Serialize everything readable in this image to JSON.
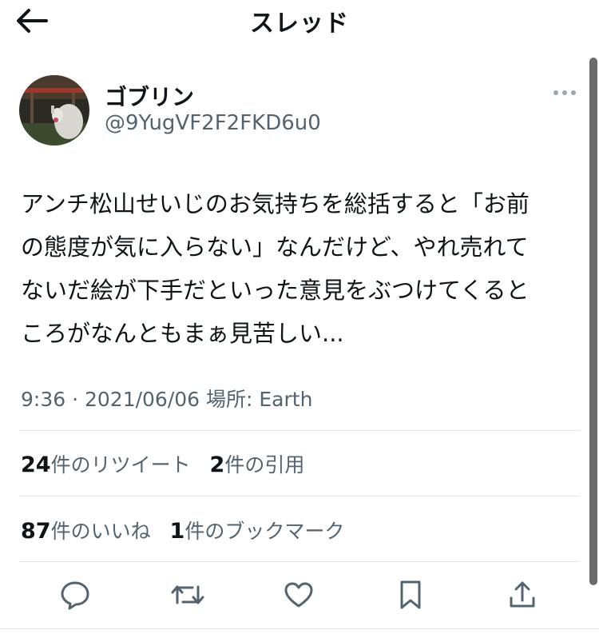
{
  "header": {
    "title": "スレッド",
    "back_icon": "arrow-left-icon"
  },
  "author": {
    "name": "ゴブリン",
    "handle": "@9YugVF2F2FKD6u0",
    "avatar_icon": "user-avatar-photo"
  },
  "tweet": {
    "lines": [
      "アンチ松山せいじのお気持ちを総括すると「お前",
      "の態度が気に入らない」なんだけど、やれ売れて",
      "ないだ絵が下手だといった意見をぶつけてくると",
      "ころがなんともまぁ見苦しい..."
    ],
    "meta": "9:36 · 2021/06/06 場所: Earth"
  },
  "stats": {
    "retweets": {
      "count": "24",
      "label": "件のリツイート"
    },
    "quotes": {
      "count": "2",
      "label": "件の引用"
    },
    "likes": {
      "count": "87",
      "label": "件のいいね"
    },
    "bookmarks": {
      "count": "1",
      "label": "件のブックマーク"
    }
  },
  "actions": [
    "reply-icon",
    "retweet-icon",
    "like-icon",
    "bookmark-icon",
    "share-icon"
  ],
  "colors": {
    "text": "#0f1419",
    "secondary": "#536471",
    "divider": "#e1e5e8"
  }
}
